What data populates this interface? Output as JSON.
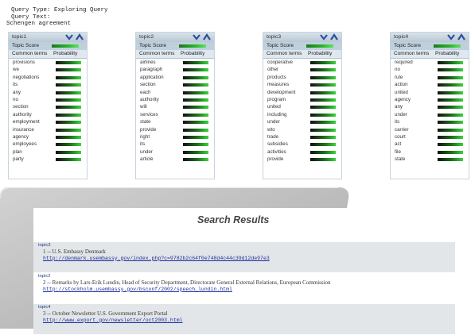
{
  "query": {
    "type_line": "Query Type: Exploring Query",
    "text_line": "Query Text:",
    "text_value": "Schengen agreement"
  },
  "panel_labels": {
    "topic_score": "Topic Score",
    "common_terms": "Common terms",
    "probability": "Probability"
  },
  "panels": [
    {
      "title": "topic1",
      "score": 0.85,
      "terms": [
        {
          "label": "provisions",
          "prob": 0.95
        },
        {
          "label": "we",
          "prob": 0.95
        },
        {
          "label": "negotiations",
          "prob": 0.95
        },
        {
          "label": "its",
          "prob": 0.95
        },
        {
          "label": "any",
          "prob": 0.95
        },
        {
          "label": "no",
          "prob": 0.95
        },
        {
          "label": "section",
          "prob": 0.95
        },
        {
          "label": "authority",
          "prob": 0.95
        },
        {
          "label": "employment",
          "prob": 0.95
        },
        {
          "label": "insurance",
          "prob": 0.95
        },
        {
          "label": "agency",
          "prob": 0.95
        },
        {
          "label": "employees",
          "prob": 0.95
        },
        {
          "label": "plan",
          "prob": 0.95
        },
        {
          "label": "party",
          "prob": 0.95
        }
      ]
    },
    {
      "title": "topic2",
      "score": 0.85,
      "terms": [
        {
          "label": "airlines",
          "prob": 0.95
        },
        {
          "label": "paragraph",
          "prob": 0.95
        },
        {
          "label": "application",
          "prob": 0.95
        },
        {
          "label": "section",
          "prob": 0.95
        },
        {
          "label": "each",
          "prob": 0.95
        },
        {
          "label": "authority",
          "prob": 0.95
        },
        {
          "label": "will",
          "prob": 0.95
        },
        {
          "label": "services",
          "prob": 0.95
        },
        {
          "label": "state",
          "prob": 0.95
        },
        {
          "label": "provide",
          "prob": 0.95
        },
        {
          "label": "right",
          "prob": 0.95
        },
        {
          "label": "its",
          "prob": 0.95
        },
        {
          "label": "under",
          "prob": 0.95
        },
        {
          "label": "article",
          "prob": 0.95
        }
      ]
    },
    {
      "title": "topic3",
      "score": 0.85,
      "terms": [
        {
          "label": "cooperative",
          "prob": 0.95
        },
        {
          "label": "other",
          "prob": 0.95
        },
        {
          "label": "products",
          "prob": 0.95
        },
        {
          "label": "measures",
          "prob": 0.95
        },
        {
          "label": "development",
          "prob": 0.95
        },
        {
          "label": "program",
          "prob": 0.95
        },
        {
          "label": "united",
          "prob": 0.95
        },
        {
          "label": "including",
          "prob": 0.95
        },
        {
          "label": "under",
          "prob": 0.95
        },
        {
          "label": "wto",
          "prob": 0.95
        },
        {
          "label": "trade",
          "prob": 0.95
        },
        {
          "label": "subsidies",
          "prob": 0.95
        },
        {
          "label": "activities",
          "prob": 0.95
        },
        {
          "label": "provide",
          "prob": 0.95
        }
      ]
    },
    {
      "title": "topic4",
      "score": 0.85,
      "terms": [
        {
          "label": "required",
          "prob": 0.95
        },
        {
          "label": "no",
          "prob": 0.95
        },
        {
          "label": "rule",
          "prob": 0.95
        },
        {
          "label": "action",
          "prob": 0.95
        },
        {
          "label": "united",
          "prob": 0.95
        },
        {
          "label": "agency",
          "prob": 0.95
        },
        {
          "label": "any",
          "prob": 0.95
        },
        {
          "label": "under",
          "prob": 0.95
        },
        {
          "label": "its",
          "prob": 0.95
        },
        {
          "label": "carrier",
          "prob": 0.95
        },
        {
          "label": "court",
          "prob": 0.95
        },
        {
          "label": "act",
          "prob": 0.95
        },
        {
          "label": "file",
          "prob": 0.95
        },
        {
          "label": "state",
          "prob": 0.95
        }
      ]
    }
  ],
  "colors": {
    "bar_green": "#2ab82a",
    "panel_header": "#bfd0dd",
    "link": "#1a2a9a"
  },
  "search_results": {
    "title": "Search Results",
    "items": [
      {
        "topic": "topic3",
        "text": "1 -- U.S. Embassy Denmark",
        "url": "http://denmark.usembassy.gov/index.php?c=9782b2c64f0e748d4c44c39d12de97e3",
        "bg": "#e3e6e8"
      },
      {
        "topic": "topic2",
        "text": "2 -- Remarks by Lars-Erik Lundin, Head of Security Department, Directorate General External Relations, European Commission",
        "url": "http://stockholm.usembassy.gov/bsconf/2002/speech_lundin.html",
        "bg": "#ffffff"
      },
      {
        "topic": "topic4",
        "text": "3 -- October Newsletter U.S. Government Export Portal",
        "url": "http://www.export.gov/newsletter/oct2003.html",
        "bg": "#e3e6e8"
      }
    ]
  }
}
